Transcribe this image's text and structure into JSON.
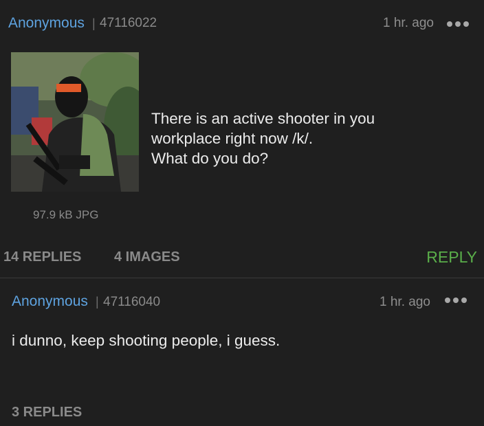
{
  "op": {
    "author": "Anonymous",
    "separator": "|",
    "post_id": "47116022",
    "time": "1 hr. ago",
    "file_info": "97.9 kB JPG",
    "body": "There is an active shooter in you\nworkplace right now /k/.\nWhat do you do?",
    "replies_label": "14 REPLIES",
    "images_label": "4 IMAGES",
    "reply_button": "REPLY",
    "thumbnail_icon": "masked-gunman-photo"
  },
  "reply": {
    "author": "Anonymous",
    "separator": "|",
    "post_id": "47116040",
    "time": "1 hr. ago",
    "body": "i dunno, keep shooting people, i guess.",
    "replies_label": "3 REPLIES"
  },
  "colors": {
    "background": "#1f1f1f",
    "name": "#5ea3e0",
    "reply_action": "#5aae4a",
    "muted": "#8a8a8a"
  }
}
